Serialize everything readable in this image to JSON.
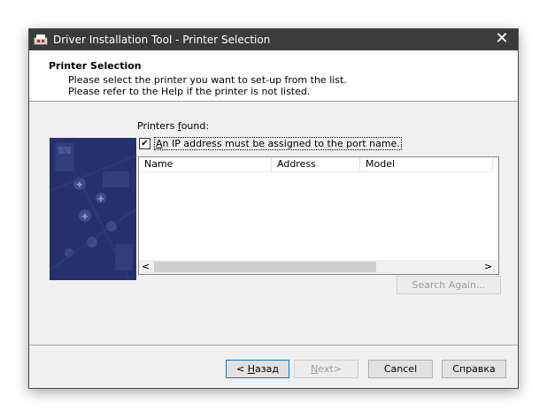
{
  "window": {
    "title": "Driver Installation Tool - Printer Selection",
    "close_glyph": "✕"
  },
  "header": {
    "title": "Printer Selection",
    "line1": "Please select the printer you want to set-up from the list.",
    "line2": "Please refer to the Help if the printer is not listed."
  },
  "printers_found": {
    "label_prefix": "Printers ",
    "label_mnemonic": "f",
    "label_suffix": "ound:"
  },
  "ip_checkbox": {
    "checked": true,
    "check_glyph": "✔",
    "label_mnemonic": "A",
    "label_rest": "n IP address must be assigned to the port name."
  },
  "printer_list": {
    "columns": [
      "Name",
      "Address",
      "Model"
    ],
    "rows": [],
    "scroll_left_glyph": "<",
    "scroll_right_glyph": ">"
  },
  "buttons": {
    "search_again": "Search Again...",
    "back_prefix": "< ",
    "back_mnemonic": "Н",
    "back_rest": "азад",
    "next_mnemonic": "N",
    "next_rest": "ext>",
    "cancel": "Cancel",
    "help": "Справка"
  },
  "colors": {
    "titlebar": "#3b3b3b",
    "dialog_bg": "#f0f0f0",
    "side_image": "#27326a",
    "focus_border": "#0078d7"
  }
}
